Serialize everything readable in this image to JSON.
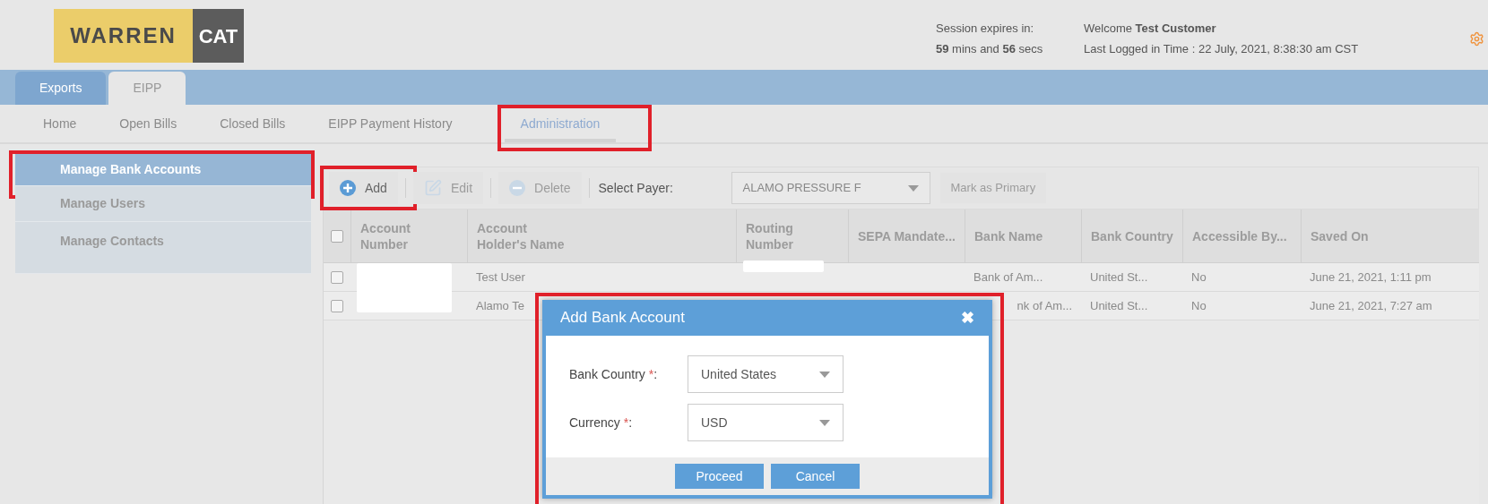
{
  "header": {
    "logo": {
      "left": "WARREN",
      "right": "CAT"
    },
    "session_label": "Session expires in:",
    "session_remaining": "**59** mins and **56** secs",
    "welcome": "Welcome **Test Customer**",
    "last_login": "Last Logged in Time : 22 July, 2021, 8:38:30 am CST"
  },
  "tabs": [
    {
      "label": "Exports",
      "selected": false
    },
    {
      "label": "EIPP",
      "selected": true
    }
  ],
  "nav": [
    {
      "label": "Home",
      "selected": false,
      "highlighted": false
    },
    {
      "label": "Open Bills",
      "selected": false,
      "highlighted": false
    },
    {
      "label": "Closed Bills",
      "selected": false,
      "highlighted": false
    },
    {
      "label": "EIPP Payment History",
      "selected": false,
      "highlighted": false
    },
    {
      "label": "Administration",
      "selected": true,
      "highlighted": true
    }
  ],
  "sidebar": {
    "items": [
      {
        "label": "Manage Bank Accounts",
        "selected": true,
        "highlighted": true
      },
      {
        "label": "Manage Users",
        "selected": false,
        "highlighted": false
      },
      {
        "label": "Manage Contacts",
        "selected": false,
        "highlighted": false
      }
    ]
  },
  "toolbar": {
    "buttons": [
      {
        "kind": "add",
        "label": "Add",
        "disabled": false,
        "highlighted": true
      },
      {
        "kind": "edit",
        "label": "Edit",
        "disabled": true,
        "highlighted": false
      },
      {
        "kind": "delete",
        "label": "Delete",
        "disabled": true,
        "highlighted": false
      }
    ],
    "payer_label": "Select Payer:",
    "payer_value": "ALAMO PRESSURE F",
    "mark_primary": {
      "label": "Mark as Primary",
      "disabled": true
    }
  },
  "table": {
    "header_checked": false,
    "columns": [
      "Account Number",
      "Account Holder's Name",
      "Routing Number",
      "SEPA Mandate...",
      "Bank Name",
      "Bank Country",
      "Accessible By...",
      "Saved On"
    ],
    "rows": [
      {
        "checked": false,
        "cells": [
          null,
          "Test User",
          null,
          null,
          "Bank of Am...",
          "United St...",
          "No",
          "June 21, 2021, 1:11 pm"
        ]
      },
      {
        "checked": false,
        "bank_name_cut": true,
        "cells": [
          null,
          "Alamo Te",
          null,
          null,
          "nk of Am...",
          "United St...",
          "No",
          "June 21, 2021, 7:27 am"
        ]
      }
    ]
  },
  "modal": {
    "title": "Add Bank Account",
    "close": "✖",
    "highlighted": true,
    "fields": [
      {
        "label": "Bank Country",
        "required": true,
        "mark": "*",
        "colon": ":",
        "value": "United States"
      },
      {
        "label": "Currency",
        "required": true,
        "mark": "*",
        "colon": ":",
        "value": "USD"
      }
    ],
    "buttons": [
      "Proceed",
      "Cancel"
    ]
  }
}
